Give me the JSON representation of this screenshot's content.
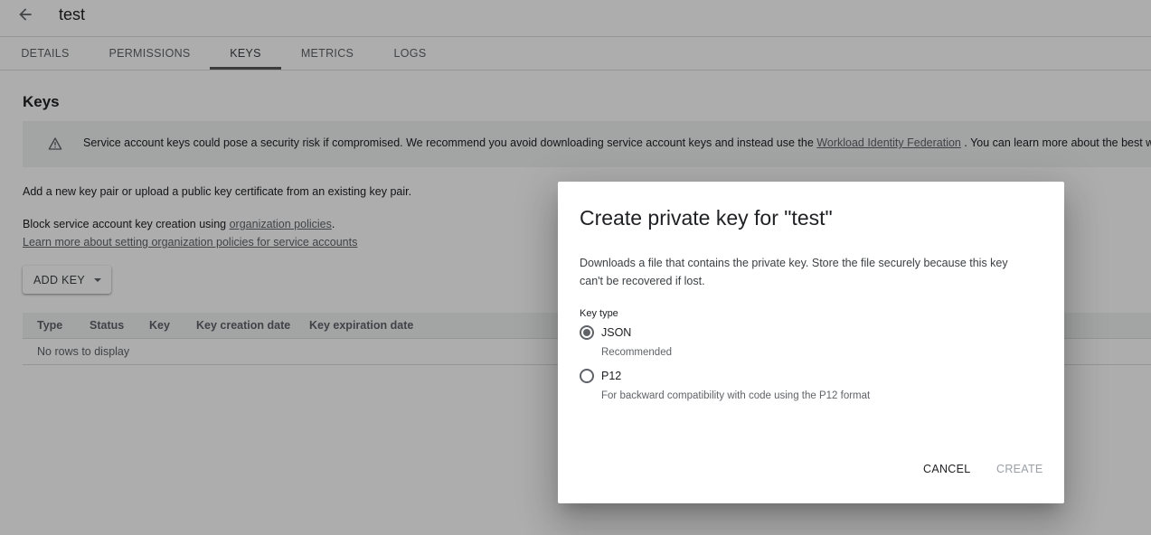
{
  "header": {
    "back_label": "Back",
    "title": "test"
  },
  "tabs": [
    {
      "label": "DETAILS",
      "active": false
    },
    {
      "label": "PERMISSIONS",
      "active": false
    },
    {
      "label": "KEYS",
      "active": true
    },
    {
      "label": "METRICS",
      "active": false
    },
    {
      "label": "LOGS",
      "active": false
    }
  ],
  "keys_section": {
    "title": "Keys",
    "banner": {
      "icon": "warning-icon",
      "text_before": "Service account keys could pose a security risk if compromised. We recommend you avoid downloading service account keys and instead use the ",
      "link_text": "Workload Identity Federation",
      "text_after": " . You can learn more about the best wa"
    },
    "intro": "Add a new key pair or upload a public key certificate from an existing key pair.",
    "policy_text": "Block service account key creation using ",
    "policy_link": "organization policies",
    "policy_suffix": ".",
    "learn_more_link": "Learn more about setting organization policies for service accounts",
    "add_key_label": "ADD KEY",
    "table": {
      "columns": [
        "Type",
        "Status",
        "Key",
        "Key creation date",
        "Key expiration date"
      ],
      "empty_message": "No rows to display"
    }
  },
  "dialog": {
    "title": "Create private key for \"test\"",
    "description": "Downloads a file that contains the private key. Store the file securely because this key can't be recovered if lost.",
    "key_type_label": "Key type",
    "options": [
      {
        "label": "JSON",
        "hint": "Recommended",
        "checked": true
      },
      {
        "label": "P12",
        "hint": "For backward compatibility with code using the P12 format",
        "checked": false
      }
    ],
    "cancel_label": "CANCEL",
    "create_label": "CREATE"
  }
}
